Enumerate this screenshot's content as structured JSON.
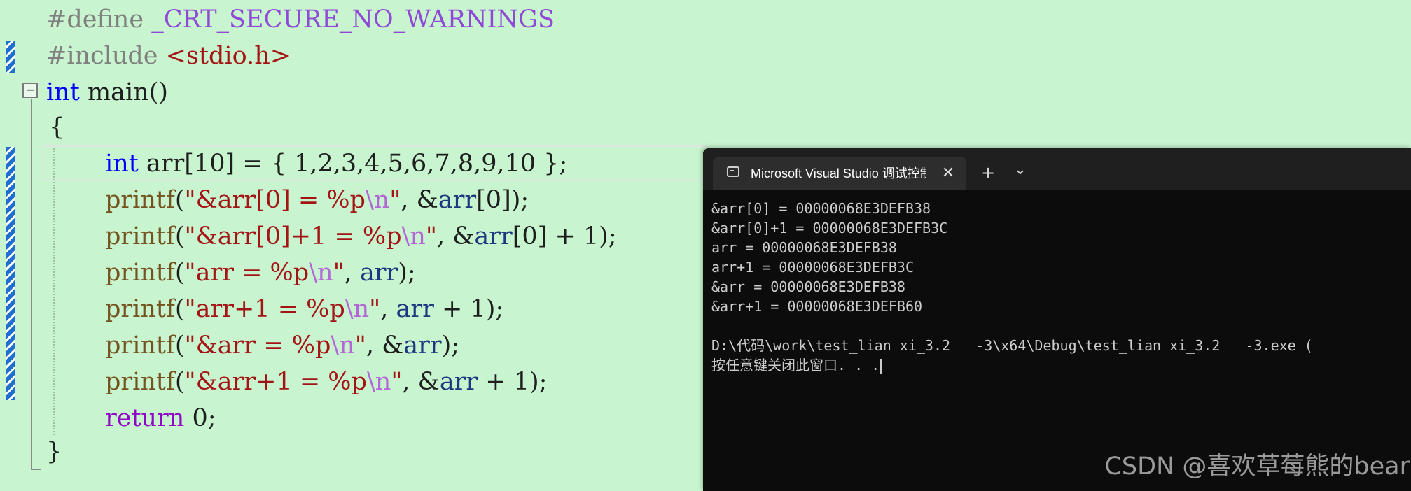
{
  "editor": {
    "fold_symbol": "−",
    "lines": {
      "l1": [
        "#define",
        " ",
        "_CRT_SECURE_NO_WARNINGS"
      ],
      "l2": [
        "#include",
        " ",
        "<stdio.h>"
      ],
      "l3": [
        "int",
        " main()"
      ],
      "l4": [
        "{"
      ],
      "l5": [
        "int",
        " arr[10] = { 1,2,3,4,5,6,7,8,9,10 };"
      ],
      "l6": [
        "printf",
        "(",
        "\"&arr[0] = %p",
        "\\n",
        "\"",
        ", &",
        "arr",
        "[0]);"
      ],
      "l7": [
        "printf",
        "(",
        "\"&arr[0]+1 = %p",
        "\\n",
        "\"",
        ", &",
        "arr",
        "[0] + 1);"
      ],
      "l8": [
        "printf",
        "(",
        "\"arr = %p",
        "\\n",
        "\"",
        ", ",
        "arr",
        ");"
      ],
      "l9": [
        "printf",
        "(",
        "\"arr+1 = %p",
        "\\n",
        "\"",
        ", ",
        "arr",
        " + 1);"
      ],
      "l10": [
        "printf",
        "(",
        "\"&arr = %p",
        "\\n",
        "\"",
        ", &",
        "arr",
        ");"
      ],
      "l11": [
        "printf",
        "(",
        "\"&arr+1 = %p",
        "\\n",
        "\"",
        ", &",
        "arr",
        " + 1);"
      ],
      "l12": [
        "return",
        " 0;"
      ],
      "l13": [
        "}"
      ]
    }
  },
  "console": {
    "tab_title": "Microsoft Visual Studio 调试控制台",
    "close_label": "✕",
    "new_tab_label": "+",
    "dropdown_label": "⌄",
    "output": [
      "&arr[0] = 00000068E3DEFB38",
      "&arr[0]+1 = 00000068E3DEFB3C",
      "arr = 00000068E3DEFB38",
      "arr+1 = 00000068E3DEFB3C",
      "&arr = 00000068E3DEFB38",
      "&arr+1 = 00000068E3DEFB60",
      "",
      "D:\\代码\\work\\test_lian xi_3.2   -3\\x64\\Debug\\test_lian xi_3.2   -3.exe (",
      "按任意键关闭此窗口. . ."
    ]
  },
  "watermark": "CSDN @喜欢草莓熊的bear"
}
